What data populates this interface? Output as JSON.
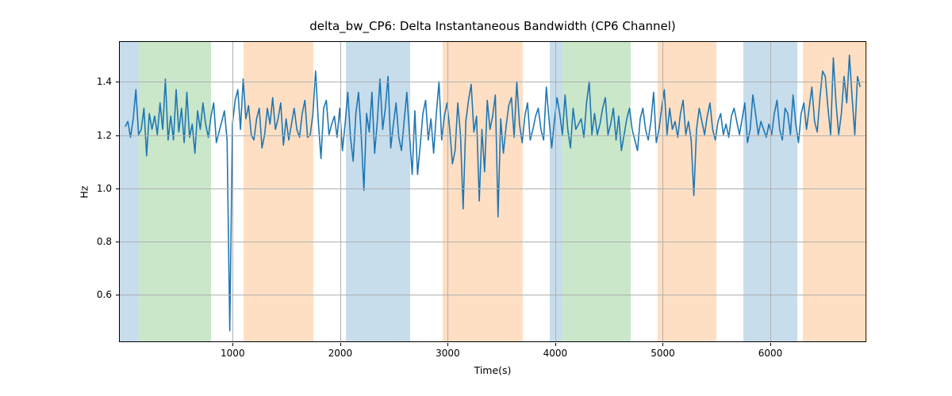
{
  "chart_data": {
    "type": "line",
    "title": "delta_bw_CP6: Delta Instantaneous Bandwidth (CP6 Channel)",
    "xlabel": "Time(s)",
    "ylabel": "Hz",
    "xlim": [
      -50,
      6900
    ],
    "ylim": [
      0.42,
      1.55
    ],
    "xticks": [
      1000,
      2000,
      3000,
      4000,
      5000,
      6000
    ],
    "yticks": [
      0.6,
      0.8,
      1.0,
      1.2,
      1.4
    ],
    "x": [
      0,
      25,
      50,
      75,
      100,
      125,
      150,
      175,
      200,
      225,
      250,
      275,
      300,
      325,
      350,
      375,
      400,
      425,
      450,
      475,
      500,
      525,
      550,
      575,
      600,
      625,
      650,
      675,
      700,
      725,
      750,
      775,
      800,
      825,
      850,
      875,
      900,
      925,
      950,
      975,
      1000,
      1025,
      1050,
      1075,
      1100,
      1125,
      1150,
      1175,
      1200,
      1225,
      1250,
      1275,
      1300,
      1325,
      1350,
      1375,
      1400,
      1425,
      1450,
      1475,
      1500,
      1525,
      1550,
      1575,
      1600,
      1625,
      1650,
      1675,
      1700,
      1725,
      1750,
      1775,
      1800,
      1825,
      1850,
      1875,
      1900,
      1925,
      1950,
      1975,
      2000,
      2025,
      2050,
      2075,
      2100,
      2125,
      2150,
      2175,
      2200,
      2225,
      2250,
      2275,
      2300,
      2325,
      2350,
      2375,
      2400,
      2425,
      2450,
      2475,
      2500,
      2525,
      2550,
      2575,
      2600,
      2625,
      2650,
      2675,
      2700,
      2725,
      2750,
      2775,
      2800,
      2825,
      2850,
      2875,
      2900,
      2925,
      2950,
      2975,
      3000,
      3025,
      3050,
      3075,
      3100,
      3125,
      3150,
      3175,
      3200,
      3225,
      3250,
      3275,
      3300,
      3325,
      3350,
      3375,
      3400,
      3425,
      3450,
      3475,
      3500,
      3525,
      3550,
      3575,
      3600,
      3625,
      3650,
      3675,
      3700,
      3725,
      3750,
      3775,
      3800,
      3825,
      3850,
      3875,
      3900,
      3925,
      3950,
      3975,
      4000,
      4025,
      4050,
      4075,
      4100,
      4125,
      4150,
      4175,
      4200,
      4225,
      4250,
      4275,
      4300,
      4325,
      4350,
      4375,
      4400,
      4425,
      4450,
      4475,
      4500,
      4525,
      4550,
      4575,
      4600,
      4625,
      4650,
      4675,
      4700,
      4725,
      4750,
      4775,
      4800,
      4825,
      4850,
      4875,
      4900,
      4925,
      4950,
      4975,
      5000,
      5025,
      5050,
      5075,
      5100,
      5125,
      5150,
      5175,
      5200,
      5225,
      5250,
      5275,
      5300,
      5325,
      5350,
      5375,
      5400,
      5425,
      5450,
      5475,
      5500,
      5525,
      5550,
      5575,
      5600,
      5625,
      5650,
      5675,
      5700,
      5725,
      5750,
      5775,
      5800,
      5825,
      5850,
      5875,
      5900,
      5925,
      5950,
      5975,
      6000,
      6025,
      6050,
      6075,
      6100,
      6125,
      6150,
      6175,
      6200,
      6225,
      6250,
      6275,
      6300,
      6325,
      6350,
      6375,
      6400,
      6425,
      6450,
      6475,
      6500,
      6525,
      6550,
      6575,
      6600,
      6625,
      6650,
      6675,
      6700,
      6725,
      6750,
      6775,
      6800,
      6825,
      6850
    ],
    "values": [
      1.23,
      1.25,
      1.19,
      1.26,
      1.37,
      1.2,
      1.22,
      1.3,
      1.12,
      1.28,
      1.22,
      1.27,
      1.2,
      1.32,
      1.22,
      1.41,
      1.18,
      1.27,
      1.18,
      1.37,
      1.21,
      1.3,
      1.17,
      1.36,
      1.19,
      1.24,
      1.13,
      1.29,
      1.22,
      1.32,
      1.24,
      1.19,
      1.27,
      1.32,
      1.17,
      1.21,
      1.25,
      1.29,
      1.18,
      0.46,
      1.24,
      1.33,
      1.37,
      1.22,
      1.41,
      1.26,
      1.31,
      1.2,
      1.18,
      1.26,
      1.3,
      1.15,
      1.2,
      1.3,
      1.24,
      1.34,
      1.22,
      1.26,
      1.32,
      1.16,
      1.26,
      1.18,
      1.24,
      1.3,
      1.22,
      1.19,
      1.28,
      1.33,
      1.19,
      1.2,
      1.28,
      1.44,
      1.25,
      1.11,
      1.3,
      1.33,
      1.2,
      1.24,
      1.27,
      1.19,
      1.3,
      1.14,
      1.24,
      1.36,
      1.19,
      1.1,
      1.28,
      1.36,
      1.2,
      0.99,
      1.28,
      1.21,
      1.36,
      1.13,
      1.25,
      1.41,
      1.22,
      1.3,
      1.42,
      1.15,
      1.24,
      1.32,
      1.19,
      1.14,
      1.25,
      1.36,
      1.2,
      1.05,
      1.29,
      1.05,
      1.16,
      1.28,
      1.33,
      1.18,
      1.26,
      1.13,
      1.28,
      1.4,
      1.18,
      1.27,
      1.32,
      1.22,
      1.09,
      1.14,
      1.32,
      1.2,
      0.92,
      1.25,
      1.33,
      1.39,
      1.21,
      1.27,
      0.95,
      1.22,
      1.06,
      1.33,
      1.22,
      1.27,
      1.35,
      0.89,
      1.26,
      1.13,
      1.23,
      1.31,
      1.34,
      1.19,
      1.4,
      1.24,
      1.17,
      1.27,
      1.32,
      1.18,
      1.22,
      1.27,
      1.3,
      1.22,
      1.18,
      1.38,
      1.26,
      1.15,
      1.25,
      1.34,
      1.28,
      1.2,
      1.35,
      1.22,
      1.15,
      1.3,
      1.22,
      1.24,
      1.26,
      1.19,
      1.32,
      1.4,
      1.2,
      1.28,
      1.2,
      1.24,
      1.3,
      1.34,
      1.2,
      1.24,
      1.3,
      1.18,
      1.27,
      1.14,
      1.2,
      1.26,
      1.3,
      1.22,
      1.18,
      1.14,
      1.26,
      1.3,
      1.22,
      1.18,
      1.25,
      1.36,
      1.17,
      1.22,
      1.3,
      1.37,
      1.2,
      1.3,
      1.22,
      1.25,
      1.19,
      1.28,
      1.33,
      1.2,
      1.25,
      1.18,
      0.97,
      1.22,
      1.3,
      1.25,
      1.2,
      1.27,
      1.32,
      1.22,
      1.18,
      1.25,
      1.28,
      1.2,
      1.24,
      1.19,
      1.27,
      1.3,
      1.25,
      1.2,
      1.26,
      1.32,
      1.17,
      1.22,
      1.35,
      1.28,
      1.2,
      1.25,
      1.22,
      1.19,
      1.24,
      1.2,
      1.28,
      1.33,
      1.22,
      1.18,
      1.3,
      1.28,
      1.2,
      1.35,
      1.24,
      1.17,
      1.28,
      1.32,
      1.22,
      1.3,
      1.38,
      1.25,
      1.21,
      1.34,
      1.44,
      1.42,
      1.3,
      1.2,
      1.49,
      1.32,
      1.2,
      1.28,
      1.42,
      1.32,
      1.5,
      1.34,
      1.2,
      1.42,
      1.38
    ],
    "bands": [
      {
        "x0": -50,
        "x1": 130,
        "color": "#1f77b4"
      },
      {
        "x0": 130,
        "x1": 800,
        "color": "#2ca02c"
      },
      {
        "x0": 1100,
        "x1": 1750,
        "color": "#ff7f0e"
      },
      {
        "x0": 2050,
        "x1": 2650,
        "color": "#1f77b4"
      },
      {
        "x0": 2950,
        "x1": 3700,
        "color": "#ff7f0e"
      },
      {
        "x0": 3950,
        "x1": 4070,
        "color": "#1f77b4"
      },
      {
        "x0": 4070,
        "x1": 4700,
        "color": "#2ca02c"
      },
      {
        "x0": 4950,
        "x1": 5500,
        "color": "#ff7f0e"
      },
      {
        "x0": 5750,
        "x1": 6250,
        "color": "#1f77b4"
      },
      {
        "x0": 6300,
        "x1": 6900,
        "color": "#ff7f0e"
      }
    ]
  }
}
